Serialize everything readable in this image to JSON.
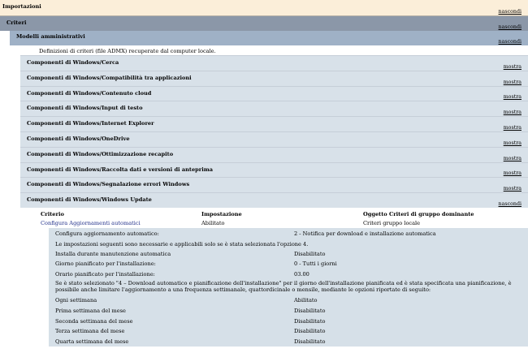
{
  "sections": {
    "importazioni": {
      "title": "Importazioni",
      "toggle": "nascondi"
    },
    "criteri": {
      "title": "Criteri",
      "toggle": "nascondi"
    },
    "modelli": {
      "title": "Modelli amministrativi",
      "toggle": "nascondi"
    }
  },
  "definizioni_text": "Definizioni di criteri (file ADMX) recuperate dal computer locale.",
  "categories": [
    {
      "title": "Componenti di Windows/Cerca",
      "toggle": "mostra"
    },
    {
      "title": "Componenti di Windows/Compatibilità tra applicazioni",
      "toggle": "mostra"
    },
    {
      "title": "Componenti di Windows/Contenuto cloud",
      "toggle": "mostra"
    },
    {
      "title": "Componenti di Windows/Input di testo",
      "toggle": "mostra"
    },
    {
      "title": "Componenti di Windows/Internet Explorer",
      "toggle": "mostra"
    },
    {
      "title": "Componenti di Windows/OneDrive",
      "toggle": "mostra"
    },
    {
      "title": "Componenti di Windows/Ottimizzazione recapito",
      "toggle": "mostra"
    },
    {
      "title": "Componenti di Windows/Raccolta dati e versioni di anteprima",
      "toggle": "mostra"
    },
    {
      "title": "Componenti di Windows/Segnalazione errori Windows",
      "toggle": "mostra"
    },
    {
      "title": "Componenti di Windows/Windows Update",
      "toggle": "nascondi"
    }
  ],
  "table": {
    "headers": [
      "Criterio",
      "Impostazione",
      "Oggetto Criteri di gruppo dominante"
    ],
    "row": [
      "Configura Aggiornamenti automatici",
      "Abilitato",
      "Criteri gruppo locale"
    ]
  },
  "settings": {
    "r1": {
      "k": "Configura aggiornamento automatico:",
      "v": "2 - Notifica per download e installazione automatica"
    },
    "p1": "Le impostazioni seguenti sono necessarie e applicabili solo se è stata selezionata l'opzione 4.",
    "r2": {
      "k": "Installa durante manutenzione automatica",
      "v": "Disabilitato"
    },
    "r3": {
      "k": "Giorno pianificato per l'installazione:",
      "v": "0 - Tutti i giorni"
    },
    "r4": {
      "k": "Orario pianificato per l'installazione:",
      "v": "03.00"
    },
    "p2": "Se è stato selezionato \"4 – Download automatico e pianificazione dell'installazione\" per il giorno dell'installazione pianificata ed è stata specificata una pianificazione, è possibile anche limitare l'aggiornamento a una frequenza settimanale, quattordicinale o mensile, mediante le opzioni riportate di seguito:",
    "r5": {
      "k": "Ogni settimana",
      "v": "Abilitato"
    },
    "r6": {
      "k": "Prima settimana del mese",
      "v": "Disabilitato"
    },
    "r7": {
      "k": "Seconda settimana del mese",
      "v": "Disabilitato"
    },
    "r8": {
      "k": "Terza settimana del mese",
      "v": "Disabilitato"
    },
    "r9": {
      "k": "Quarta settimana del mese",
      "v": "Disabilitato"
    }
  }
}
